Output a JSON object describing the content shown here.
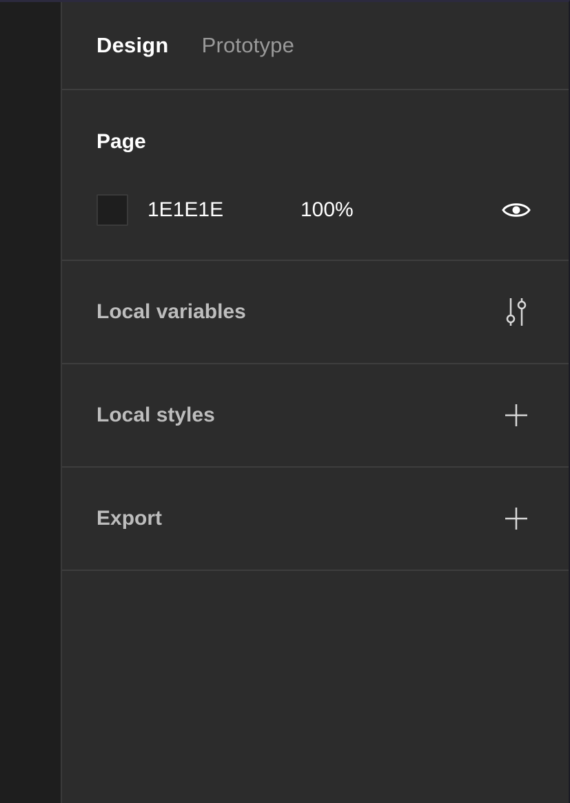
{
  "tabs": [
    {
      "label": "Design",
      "active": true
    },
    {
      "label": "Prototype",
      "active": false
    }
  ],
  "page": {
    "title": "Page",
    "fill": {
      "color": "#1E1E1E",
      "hex": "1E1E1E",
      "opacity": "100%",
      "visibility_icon": "eye-icon"
    }
  },
  "sections": {
    "local_variables": {
      "label": "Local variables",
      "icon": "sliders-icon"
    },
    "local_styles": {
      "label": "Local styles",
      "icon": "plus-icon"
    },
    "export": {
      "label": "Export",
      "icon": "plus-icon"
    }
  }
}
